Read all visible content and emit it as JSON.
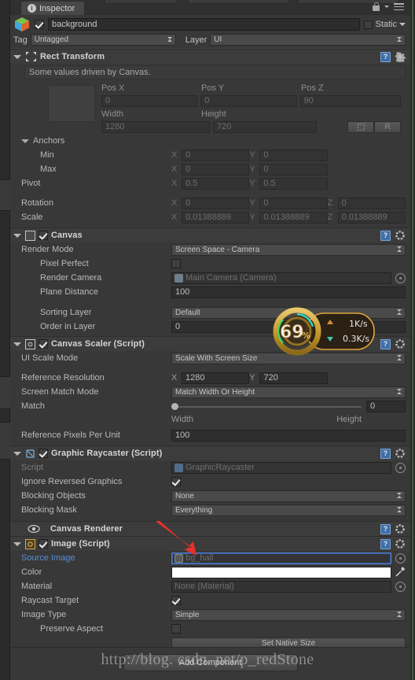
{
  "window": {
    "tab_label": "Inspector",
    "tab_icon": "info-icon",
    "lock_icon": "lock-icon",
    "menu_icon": "hamburger-menu-icon"
  },
  "object_header": {
    "icon": "gameobject-cube-icon",
    "enabled": true,
    "name": "background",
    "static_label": "Static",
    "static_checked": false,
    "tag_label": "Tag",
    "tag_value": "Untagged",
    "layer_label": "Layer",
    "layer_value": "UI"
  },
  "components": [
    {
      "id": "rect-transform",
      "title": "Rect Transform",
      "icon": "rect-transform-icon",
      "has_checkbox": false,
      "help_icon": "help-book-icon",
      "gear_icon": "gear-icon",
      "info_text": "Some values driven by Canvas.",
      "pos_headers": [
        "Pos X",
        "Pos Y",
        "Pos Z"
      ],
      "pos_values": [
        "0",
        "0",
        "90"
      ],
      "size_headers": [
        "Width",
        "Height"
      ],
      "size_values": [
        "1280",
        "720"
      ],
      "blueprint_button": "blueprint-mode-icon",
      "raw_button": "R",
      "anchors_label": "Anchors",
      "anchor_rows": [
        {
          "label": "Min",
          "x": "0",
          "y": "0"
        },
        {
          "label": "Max",
          "x": "0",
          "y": "0"
        },
        {
          "label": "Pivot",
          "x": "0.5",
          "y": "0.5"
        }
      ],
      "transform_rows": [
        {
          "label": "Rotation",
          "x": "0",
          "y": "0",
          "z": "0"
        },
        {
          "label": "Scale",
          "x": "0.01388889",
          "y": "0.01388889",
          "z": "0.01388889"
        }
      ],
      "axis_labels": [
        "X",
        "Y",
        "Z"
      ]
    },
    {
      "id": "canvas",
      "title": "Canvas",
      "icon": "canvas-icon",
      "enabled": true,
      "help_icon": "help-book-icon",
      "gear_icon": "gear-icon",
      "rows": [
        {
          "label": "Render Mode",
          "type": "popup",
          "value": "Screen Space - Camera"
        },
        {
          "label": "Pixel Perfect",
          "type": "checkbox",
          "value": false,
          "indent": 2
        },
        {
          "label": "Render Camera",
          "type": "object",
          "value": "Main Camera (Camera)",
          "indent": 2,
          "dim": true
        },
        {
          "label": "Plane Distance",
          "type": "text",
          "value": "100",
          "indent": 2
        },
        {
          "label": "",
          "type": "spacer"
        },
        {
          "label": "Sorting Layer",
          "type": "popup",
          "value": "Default",
          "indent": 2
        },
        {
          "label": "Order in Layer",
          "type": "text",
          "value": "0",
          "indent": 2
        }
      ]
    },
    {
      "id": "canvas-scaler",
      "title": "Canvas Scaler (Script)",
      "icon": "canvas-scaler-icon",
      "enabled": true,
      "help_icon": "help-book-icon",
      "gear_icon": "gear-icon",
      "ui_scale_mode_label": "UI Scale Mode",
      "ui_scale_mode_value": "Scale With Screen Size",
      "reference_resolution_label": "Reference Resolution",
      "reference_resolution_x": "1280",
      "reference_resolution_y": "720",
      "screen_match_mode_label": "Screen Match Mode",
      "screen_match_mode_value": "Match Width Or Height",
      "match_label": "Match",
      "match_value": "0",
      "match_left_label": "Width",
      "match_right_label": "Height",
      "ref_ppu_label": "Reference Pixels Per Unit",
      "ref_ppu_value": "100"
    },
    {
      "id": "graphic-raycaster",
      "title": "Graphic Raycaster (Script)",
      "icon": "graphic-raycaster-icon",
      "enabled": true,
      "help_icon": "help-book-icon",
      "gear_icon": "gear-icon",
      "rows": [
        {
          "label": "Script",
          "type": "object",
          "value": "GraphicRaycaster",
          "dim": true
        },
        {
          "label": "Ignore Reversed Graphics",
          "type": "checkbox",
          "value": true
        },
        {
          "label": "Blocking Objects",
          "type": "popup",
          "value": "None"
        },
        {
          "label": "Blocking Mask",
          "type": "popup",
          "value": "Everything"
        }
      ]
    },
    {
      "id": "canvas-renderer",
      "title": "Canvas Renderer",
      "icon": "eye-icon",
      "has_checkbox": false,
      "collapsed": true,
      "help_icon": "help-book-icon",
      "gear_icon": "gear-icon"
    },
    {
      "id": "image-script",
      "title": "Image (Script)",
      "icon": "image-script-icon",
      "enabled": true,
      "help_icon": "help-book-icon",
      "gear_icon": "gear-icon",
      "source_image_label": "Source Image",
      "source_image_value": "bg_hall",
      "source_image_focused": true,
      "color_label": "Color",
      "color_value": "#FFFFFF",
      "eyedropper_icon": "eyedropper-icon",
      "material_label": "Material",
      "material_value": "None (Material)",
      "raycast_target_label": "Raycast Target",
      "raycast_target_value": true,
      "image_type_label": "Image Type",
      "image_type_value": "Simple",
      "preserve_aspect_label": "Preserve Aspect",
      "preserve_aspect_value": false,
      "set_native_size_label": "Set Native Size"
    }
  ],
  "footer": {
    "add_component_label": "Add Component"
  },
  "overlays": {
    "watermark_text": "http://blog. csdn. net/p_redStone",
    "annotation_arrow": "red-arrow-pointing-to-source-image",
    "net_widget": {
      "percent": "69",
      "percent_unit": "%",
      "upload_speed": "1K/s",
      "download_speed": "0.3K/s",
      "upload_icon": "arrow-up-icon",
      "download_icon": "arrow-down-icon",
      "ring_color": "#d9a32a",
      "accent_color": "#e8e0d0"
    }
  }
}
